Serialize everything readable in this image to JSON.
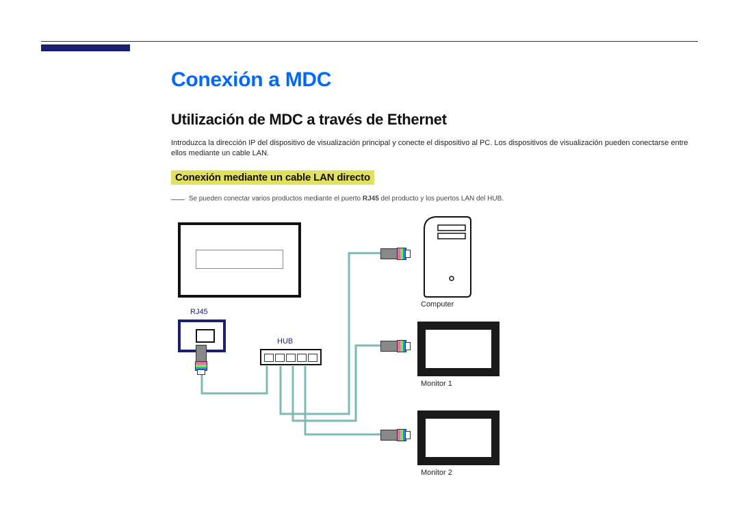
{
  "title": "Conexión a MDC",
  "section_title": "Utilización de MDC a través de Ethernet",
  "body_text": "Introduzca la dirección IP del dispositivo de visualización principal y conecte el dispositivo al PC. Los dispositivos de visualización pueden conectarse entre ellos mediante un cable LAN.",
  "highlight_heading": "Conexión mediante un cable LAN directo",
  "note": {
    "dash": "―",
    "pre": "Se pueden conectar varios productos mediante el puerto ",
    "bold": "RJ45",
    "post": " del producto y los puertos LAN del HUB."
  },
  "labels": {
    "rj45": "RJ45",
    "hub": "HUB",
    "computer": "Computer",
    "monitor1": "Monitor 1",
    "monitor2": "Monitor 2"
  }
}
